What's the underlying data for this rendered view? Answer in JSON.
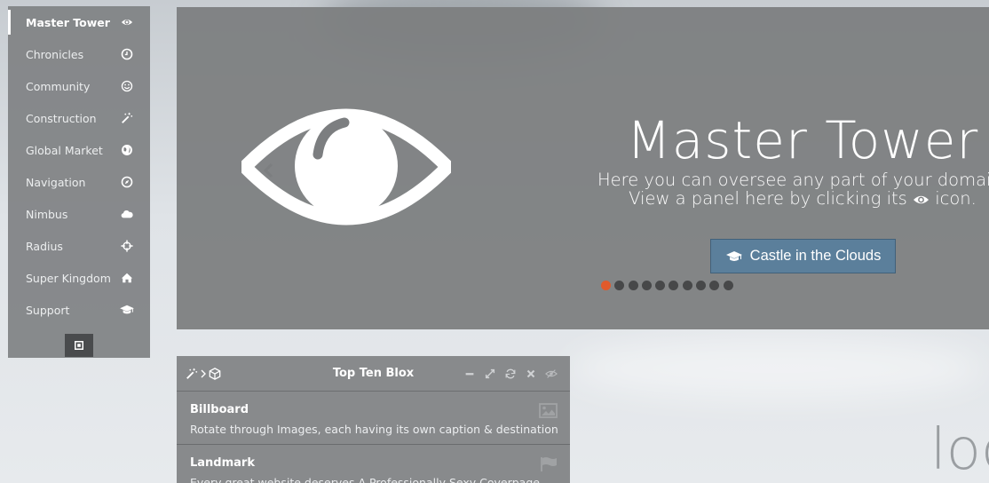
{
  "sidebar": {
    "items": [
      {
        "label": "Master Tower",
        "icon": "eye-icon",
        "active": true
      },
      {
        "label": "Chronicles",
        "icon": "clock-icon"
      },
      {
        "label": "Community",
        "icon": "smile-icon"
      },
      {
        "label": "Construction",
        "icon": "magic-wand-icon"
      },
      {
        "label": "Global Market",
        "icon": "globe-icon"
      },
      {
        "label": "Navigation",
        "icon": "compass-icon"
      },
      {
        "label": "Nimbus",
        "icon": "cloud-icon"
      },
      {
        "label": "Radius",
        "icon": "crosshairs-icon"
      },
      {
        "label": "Super Kingdom",
        "icon": "home-icon"
      },
      {
        "label": "Support",
        "icon": "graduation-cap-icon"
      }
    ]
  },
  "billboard": {
    "title": "Master Tower",
    "desc_line1": "Here you can oversee any part of your domain.",
    "desc_line2_pre": "View a panel here by clicking its",
    "desc_line2_post": "icon.",
    "button_label": "Castle in the Clouds",
    "slide_count": 10,
    "active_slide": 1,
    "accent_color": "#e15a2b"
  },
  "panel": {
    "title": "Top Ten Blox",
    "rows": [
      {
        "title": "Billboard",
        "desc": "Rotate through Images, each having its own caption & destination",
        "icon": "image-icon"
      },
      {
        "title": "Landmark",
        "desc": "Every great website deserves A Professionally Sexy Coverpage",
        "icon": "flag-icon"
      }
    ]
  },
  "background_text": "loo"
}
